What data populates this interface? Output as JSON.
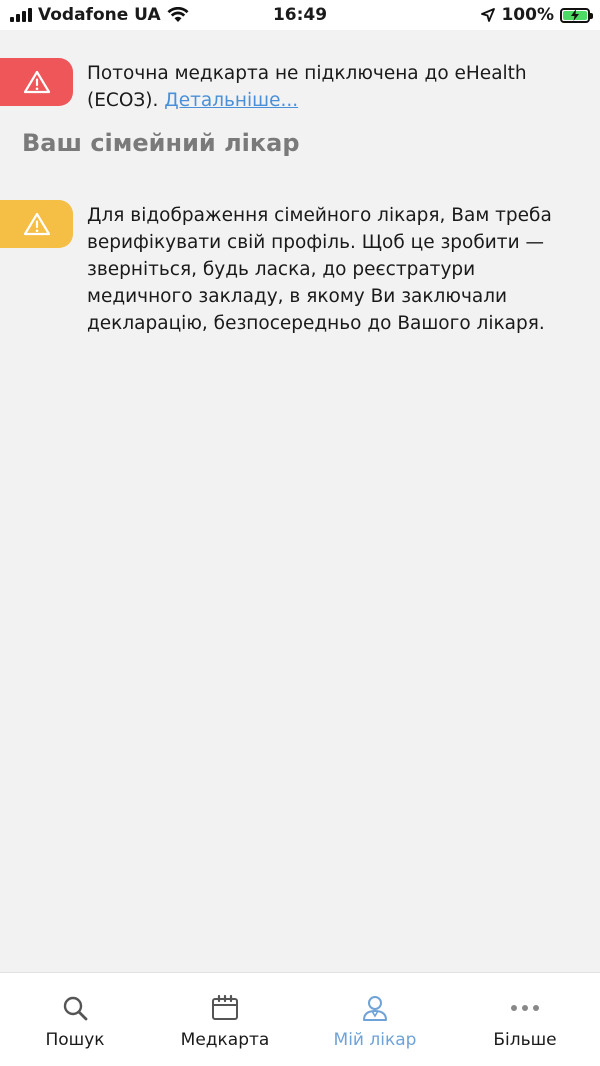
{
  "status_bar": {
    "carrier": "Vodafone UA",
    "time": "16:49",
    "battery": "100%"
  },
  "alerts": {
    "ehealth": {
      "text": "Поточна медкарта не підключена до eHealth (ЕСОЗ).",
      "link": "Детальніше..."
    },
    "verify": {
      "text": "Для відображення сімейного лікаря, Вам треба верифікувати свій профіль. Щоб це зробити — зверніться, будь ласка,  до реєстратури медичного закладу, в якому Ви заключали декларацію, безпосередньо до Вашого лікаря."
    }
  },
  "section": {
    "title": "Ваш сімейний лікар"
  },
  "tabs": [
    {
      "label": "Пошук",
      "icon": "search-icon"
    },
    {
      "label": "Медкарта",
      "icon": "calendar-icon"
    },
    {
      "label": "Мій лікар",
      "icon": "doctor-icon"
    },
    {
      "label": "Більше",
      "icon": "more-icon"
    }
  ],
  "colors": {
    "error": "#ee5659",
    "warning": "#f5be44",
    "accent": "#6fa3d8",
    "link": "#4a90d9"
  }
}
